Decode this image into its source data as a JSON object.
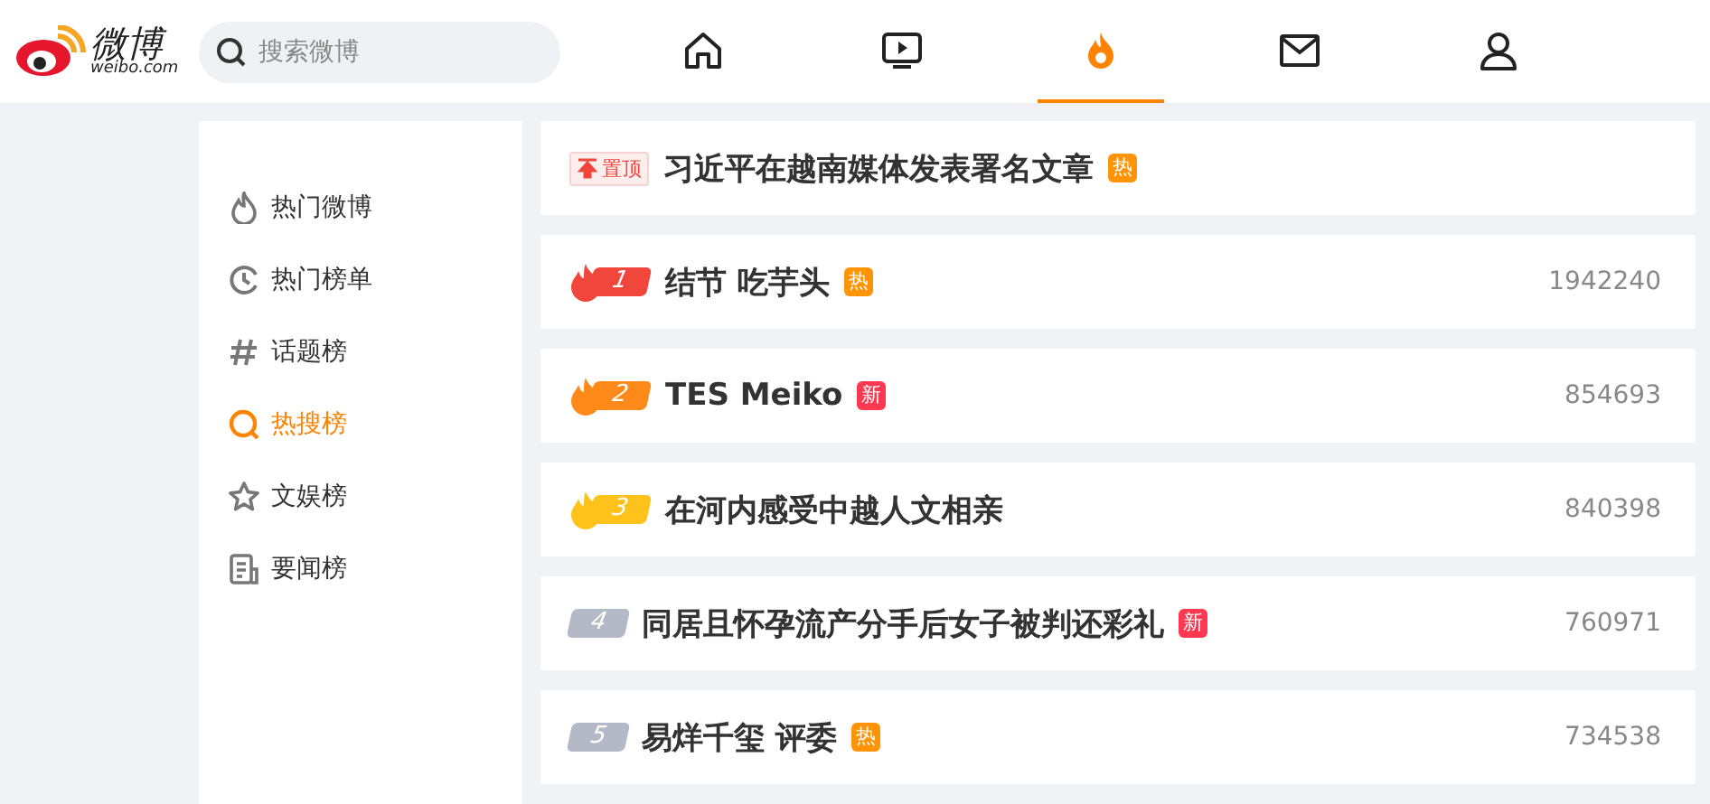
{
  "logo": {
    "name": "微博",
    "domain": "weibo.com"
  },
  "search": {
    "placeholder": "搜索微博"
  },
  "nav": [
    {
      "kind": "home",
      "selected": false
    },
    {
      "kind": "video",
      "selected": false
    },
    {
      "kind": "fire",
      "selected": true
    },
    {
      "kind": "mail",
      "selected": false
    },
    {
      "kind": "user",
      "selected": false
    }
  ],
  "sidebar": {
    "items": [
      {
        "kind": "flame",
        "label": "热门微博",
        "selected": false
      },
      {
        "kind": "clock",
        "label": "热门榜单",
        "selected": false
      },
      {
        "kind": "hash",
        "label": "话题榜",
        "selected": false
      },
      {
        "kind": "search",
        "label": "热搜榜",
        "selected": true
      },
      {
        "kind": "star",
        "label": "文娱榜",
        "selected": false
      },
      {
        "kind": "doc",
        "label": "要闻榜",
        "selected": false
      }
    ]
  },
  "hot_list": [
    {
      "kind": "pinned",
      "badge": "置顶",
      "title": "习近平在越南媒体发表署名文章",
      "tag": {
        "text": "热",
        "color": "#ff9406"
      }
    },
    {
      "kind": "flame",
      "rank": "1",
      "color": "#f0463c",
      "title": "结节 吃芋头",
      "tag": {
        "text": "热",
        "color": "#ff9406"
      },
      "count": "1942240"
    },
    {
      "kind": "flame",
      "rank": "2",
      "color": "#ff8a1a",
      "title": "TES Meiko",
      "tag": {
        "text": "新",
        "color": "#ff3852"
      },
      "count": "854693"
    },
    {
      "kind": "flame",
      "rank": "3",
      "color": "#ffc21a",
      "title": "在河内感受中越人文相亲",
      "count": "840398"
    },
    {
      "kind": "plain",
      "rank": "4",
      "color": "#b4b9c8",
      "title": "同居且怀孕流产分手后女子被判还彩礼",
      "tag": {
        "text": "新",
        "color": "#ff3852"
      },
      "count": "760971"
    },
    {
      "kind": "plain",
      "rank": "5",
      "color": "#b4b9c8",
      "title": "易烊千玺 评委",
      "tag": {
        "text": "热",
        "color": "#ff9406"
      },
      "count": "734538"
    }
  ]
}
